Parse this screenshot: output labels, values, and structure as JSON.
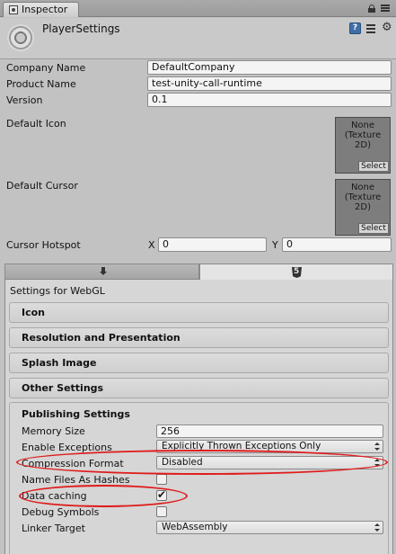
{
  "window": {
    "tab_title": "Inspector",
    "icons": [
      "lock-icon",
      "tab-menu-icon"
    ]
  },
  "header": {
    "title": "PlayerSettings",
    "icons": [
      "gear-icon",
      "help-icon",
      "preset-icon",
      "settings-menu-icon"
    ]
  },
  "fields": {
    "company_name": {
      "label": "Company Name",
      "value": "DefaultCompany"
    },
    "product_name": {
      "label": "Product Name",
      "value": "test-unity-call-runtime"
    },
    "version": {
      "label": "Version",
      "value": "0.1"
    },
    "default_icon": {
      "label": "Default Icon",
      "slot_none": "None",
      "slot_type": "(Texture 2D)",
      "select": "Select"
    },
    "default_cursor": {
      "label": "Default Cursor",
      "slot_none": "None",
      "slot_type": "(Texture 2D)",
      "select": "Select"
    },
    "cursor_hotspot": {
      "label": "Cursor Hotspot",
      "x_label": "X",
      "x_value": "0",
      "y_label": "Y",
      "y_value": "0"
    }
  },
  "platform_tabs": [
    {
      "icon": "download-icon",
      "selected": false
    },
    {
      "icon": "html5-icon",
      "selected": true
    }
  ],
  "settings_for": "Settings for WebGL",
  "sections": [
    {
      "label": "Icon"
    },
    {
      "label": "Resolution and Presentation"
    },
    {
      "label": "Splash Image"
    },
    {
      "label": "Other Settings"
    }
  ],
  "publishing": {
    "title": "Publishing Settings",
    "memory_size": {
      "label": "Memory Size",
      "value": "256"
    },
    "enable_exceptions": {
      "label": "Enable Exceptions",
      "value": "Explicitly Thrown Exceptions Only"
    },
    "compression_format": {
      "label": "Compression Format",
      "value": "Disabled"
    },
    "name_files_as_hashes": {
      "label": "Name Files As Hashes",
      "checked": false
    },
    "data_caching": {
      "label": "Data caching",
      "checked": true
    },
    "debug_symbols": {
      "label": "Debug Symbols",
      "checked": false
    },
    "linker_target": {
      "label": "Linker Target",
      "value": "WebAssembly"
    }
  },
  "annotation_color": "#e01b1b"
}
